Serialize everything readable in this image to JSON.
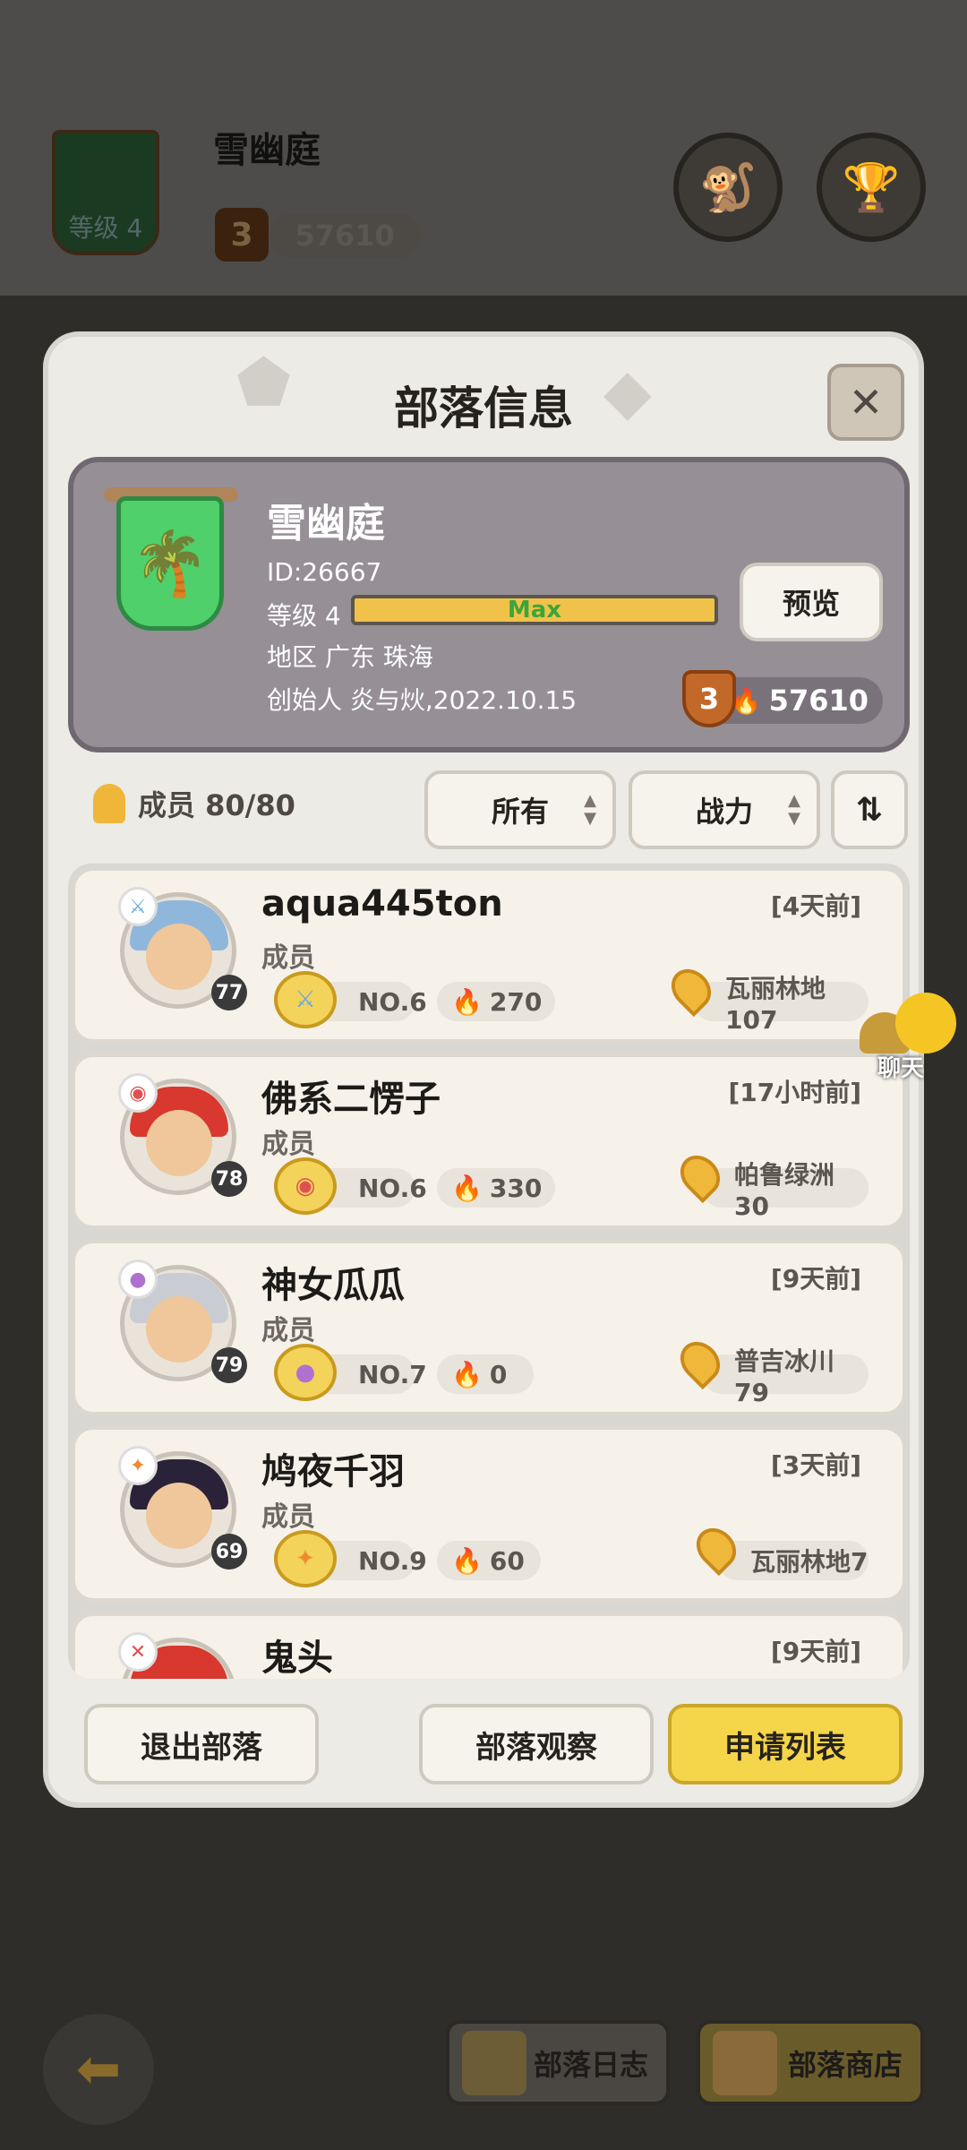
{
  "background": {
    "tribe_name": "雪幽庭",
    "banner_level": "等级 4",
    "level_badge": "3",
    "power": "57610",
    "nav_buttons": [
      "部落日志",
      "部落商店"
    ]
  },
  "modal": {
    "title": "部落信息",
    "close_symbol": "✕",
    "tribe": {
      "name": "雪幽庭",
      "id": "ID:26667",
      "level_label": "等级 4",
      "level_bar_text": "Max",
      "region": "地区 广东 珠海",
      "founder": "创始人 炎与炏,2022.10.15",
      "preview_label": "预览",
      "shield_level": "3",
      "power": "57610"
    },
    "members_label": "成员 80/80",
    "filters": {
      "all_label": "所有",
      "power_label": "战力",
      "sort_icon": "sort-icon"
    },
    "members": [
      {
        "name": "aqua445ton",
        "time": "[4天前]",
        "role": "成员",
        "level": "77",
        "rank": "NO.6",
        "power": "270",
        "location": "瓦丽林地107",
        "hair": "#8fb7dc",
        "badge_color": "#6aa8e0"
      },
      {
        "name": "佛系二愣子",
        "time": "[17小时前]",
        "role": "成员",
        "level": "78",
        "rank": "NO.6",
        "power": "330",
        "location": "帕鲁绿洲30",
        "hair": "#d8382e",
        "badge_color": "#e05050"
      },
      {
        "name": "神女瓜瓜",
        "time": "[9天前]",
        "role": "成员",
        "level": "79",
        "rank": "NO.7",
        "power": "0",
        "location": "普吉冰川79",
        "hair": "#c9ccd2",
        "badge_color": "#b070d0"
      },
      {
        "name": "鸠夜千羽",
        "time": "[3天前]",
        "role": "成员",
        "level": "69",
        "rank": "NO.9",
        "power": "60",
        "location": "瓦丽林地7",
        "hair": "#2a2238",
        "badge_color": "#f08a30"
      },
      {
        "name": "鬼头",
        "time": "[9天前]"
      }
    ],
    "buttons": {
      "leave": "退出部落",
      "observe": "部落观察",
      "apply_list": "申请列表"
    }
  },
  "chat": {
    "label": "聊天"
  }
}
